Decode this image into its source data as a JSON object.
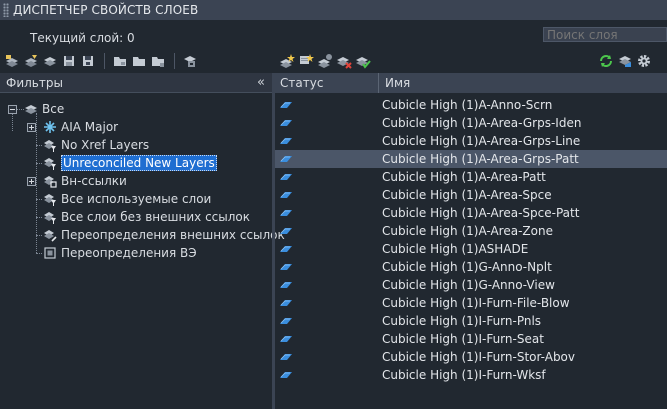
{
  "window": {
    "title": "ДИСПЕТЧЕР СВОЙСТВ СЛОЕВ"
  },
  "current_layer": "Текущий слой: 0",
  "search": {
    "placeholder": "Поиск слоя"
  },
  "left_toolbar": [
    "new-property-filter-icon",
    "new-group-filter-icon",
    "layer-states-manager-icon",
    "save-state-icon",
    "restore-state-icon",
    "merge-icon",
    "move-icon",
    "rename-icon",
    "settings-icon"
  ],
  "layer_toolbar": [
    "new-layer-icon",
    "new-layer-vp-frozen-icon",
    "delete-layer-icon",
    "set-current-icon"
  ],
  "right_toolbar": [
    "refresh-icon",
    "layer-transparency-icon",
    "settings-gear-icon"
  ],
  "filters": {
    "header": "Фильтры",
    "collapse": "«",
    "items": [
      {
        "label": "Все",
        "icon": "layers-icon"
      },
      {
        "label": "AIA Major",
        "icon": "snowflake-filter-icon"
      },
      {
        "label": "No Xref Layers",
        "icon": "property-filter-icon"
      },
      {
        "label": "Unreconciled New Layers",
        "icon": "property-filter-icon"
      },
      {
        "label": "Вн-ссылки",
        "icon": "xref-filter-icon"
      },
      {
        "label": "Все используемые слои",
        "icon": "property-filter-icon"
      },
      {
        "label": "Все слои без внешних ссылок",
        "icon": "property-filter-icon"
      },
      {
        "label": "Переопределения внешних ссылок",
        "icon": "override-filter-icon"
      },
      {
        "label": "Переопределения ВЭ",
        "icon": "viewport-override-icon"
      }
    ]
  },
  "grid": {
    "columns": [
      "Статус",
      "Имя"
    ],
    "rows": [
      "Cubicle High (1)A-Anno-Scrn",
      "Cubicle High (1)A-Area-Grps-Iden",
      "Cubicle High (1)A-Area-Grps-Line",
      "Cubicle High (1)A-Area-Grps-Patt",
      "Cubicle High (1)A-Area-Patt",
      "Cubicle High (1)A-Area-Spce",
      "Cubicle High (1)A-Area-Spce-Patt",
      "Cubicle High (1)A-Area-Zone",
      "Cubicle High (1)ASHADE",
      "Cubicle High (1)G-Anno-Nplt",
      "Cubicle High (1)G-Anno-View",
      "Cubicle High (1)I-Furn-File-Blow",
      "Cubicle High (1)I-Furn-Pnls",
      "Cubicle High (1)I-Furn-Seat",
      "Cubicle High (1)I-Furn-Stor-Abov",
      "Cubicle High (1)I-Furn-Wksf"
    ],
    "selected_index": 3
  },
  "colors": {
    "background": "#212830",
    "header": "#3b4453",
    "selection": "#4b5668",
    "filter_selection": "#1f6ed1",
    "layer_icon": "#3a8ede"
  }
}
